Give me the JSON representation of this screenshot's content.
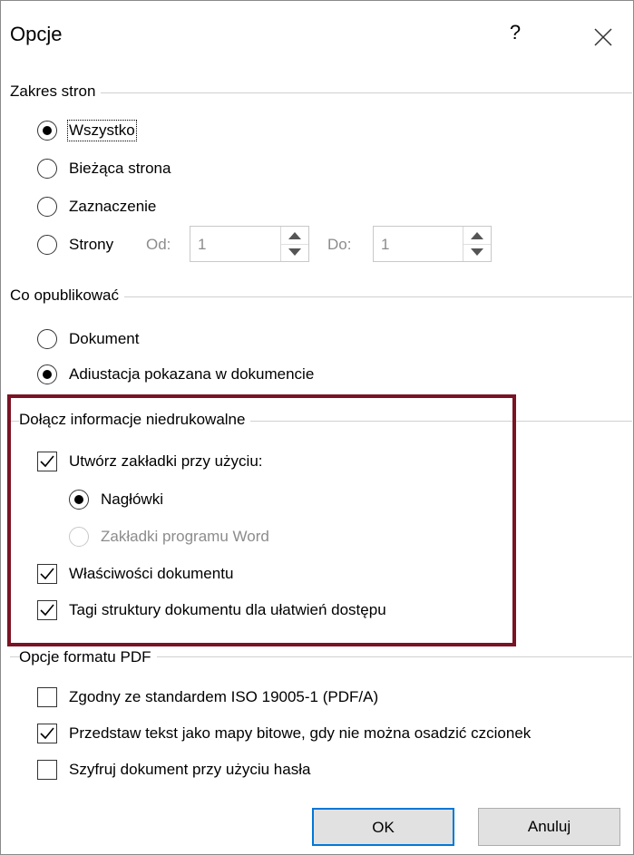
{
  "window": {
    "title": "Opcje",
    "help_label": "?"
  },
  "page_range": {
    "label": "Zakres stron",
    "options": [
      {
        "label": "Wszystko",
        "checked": true
      },
      {
        "label": "Bieżąca strona",
        "checked": false
      },
      {
        "label": "Zaznaczenie",
        "checked": false
      },
      {
        "label": "Strony",
        "checked": false
      }
    ],
    "from_label": "Od:",
    "from_value": "1",
    "to_label": "Do:",
    "to_value": "1"
  },
  "publish_what": {
    "label": "Co opublikować",
    "options": [
      {
        "label": "Dokument",
        "checked": false
      },
      {
        "label": "Adiustacja pokazana w dokumencie",
        "checked": true
      }
    ]
  },
  "non_printing": {
    "label": "Dołącz informacje niedrukowalne",
    "create_bookmarks": {
      "label": "Utwórz zakładki przy użyciu:",
      "checked": true
    },
    "bookmark_options": [
      {
        "label": "Nagłówki",
        "checked": true,
        "disabled": false
      },
      {
        "label": "Zakładki programu Word",
        "checked": false,
        "disabled": true
      }
    ],
    "doc_properties": {
      "label": "Właściwości dokumentu",
      "checked": true
    },
    "structure_tags": {
      "label": "Tagi struktury dokumentu dla ułatwień dostępu",
      "checked": true
    }
  },
  "pdf_options": {
    "label": "Opcje formatu PDF",
    "iso": {
      "label": "Zgodny ze standardem ISO 19005-1 (PDF/A)",
      "checked": false
    },
    "bitmap": {
      "label": "Przedstaw tekst jako mapy bitowe, gdy nie można osadzić czcionek",
      "checked": true
    },
    "encrypt": {
      "label": "Szyfruj dokument przy użyciu hasła",
      "checked": false
    }
  },
  "buttons": {
    "ok": "OK",
    "cancel": "Anuluj"
  },
  "colors": {
    "highlight_border": "#7a1323",
    "focus_border": "#0078d7"
  }
}
